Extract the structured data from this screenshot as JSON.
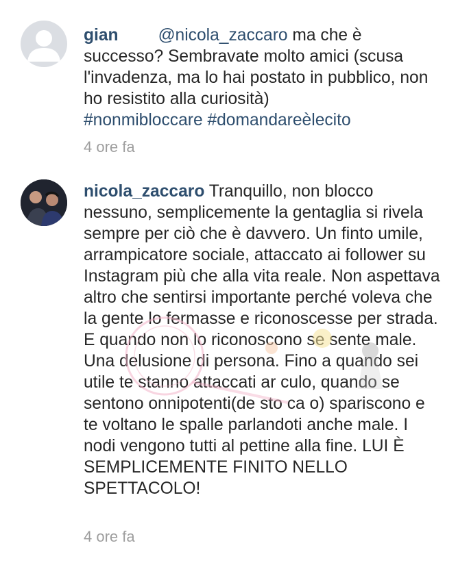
{
  "comments": [
    {
      "username": "gian",
      "mention": "@nicola_zaccaro",
      "text": " ma che è successo? Sembravate molto amici (scusa l'invadenza, ma lo hai postato in pubblico, non ho resistito alla curiosità)",
      "hashtags": "#nonmibloccare #domandareèlecito",
      "time": "4 ore fa",
      "avatar": "default-user-icon"
    },
    {
      "username": "nicola_zaccaro",
      "text": "Tranquillo,  non blocco nessuno, semplicemente la gentaglia si rivela sempre per ciò che è davvero. Un finto umile, arrampicatore sociale, attaccato ai follower su Instagram più che alla vita reale. Non aspettava altro che sentirsi importante perché voleva che la gente lo fermasse e riconoscesse per strada. E quando non lo riconoscono se sente male. Una delusione di persona. Fino a quando sei utile te stanno attaccati ar culo, quando se sentono onnipotenti(de sto ca    o) spariscono e te voltano le spalle parlandoti anche male. I nodi vengono tutti al pettine alla fine. LUI È SEMPLICEMENTE FINITO NELLO SPETTACOLO!",
      "time": "4 ore fa",
      "avatar": "profile-photo"
    }
  ],
  "colors": {
    "username": "#2e4e6e",
    "text": "#262626",
    "timestamp": "#9e9e9e",
    "watermark": "#f3b3c8"
  }
}
